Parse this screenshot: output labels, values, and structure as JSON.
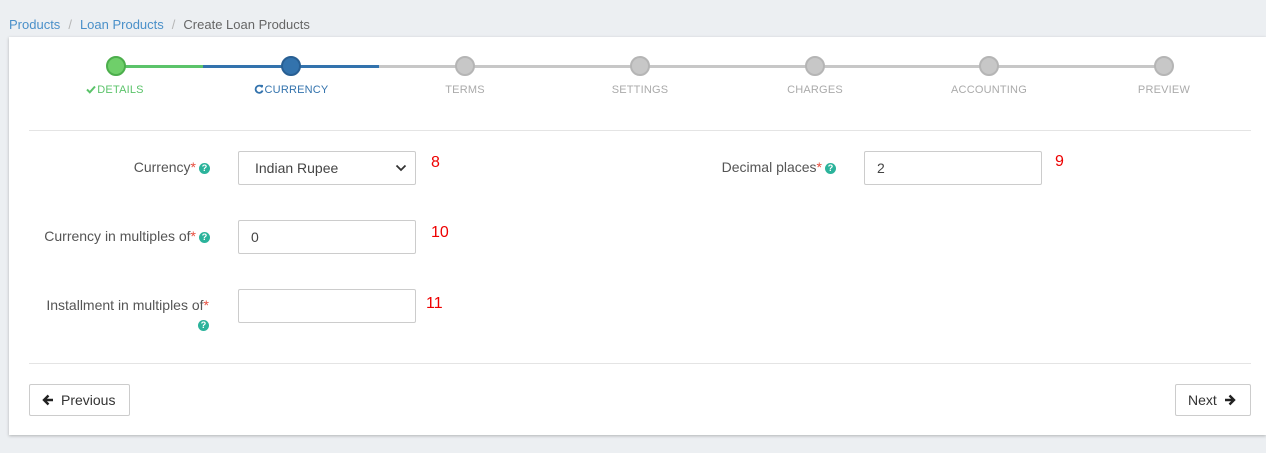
{
  "breadcrumb": {
    "items": [
      "Products",
      "Loan Products"
    ],
    "current": "Create Loan Products"
  },
  "stepper": {
    "steps": [
      {
        "label": "DETAILS",
        "state": "complete"
      },
      {
        "label": "CURRENCY",
        "state": "active"
      },
      {
        "label": "TERMS",
        "state": "pending"
      },
      {
        "label": "SETTINGS",
        "state": "pending"
      },
      {
        "label": "CHARGES",
        "state": "pending"
      },
      {
        "label": "ACCOUNTING",
        "state": "pending"
      },
      {
        "label": "PREVIEW",
        "state": "pending"
      }
    ]
  },
  "form": {
    "currency": {
      "label": "Currency",
      "required": "*",
      "value": "Indian Rupee",
      "annotation": "8"
    },
    "decimal_places": {
      "label": "Decimal places",
      "required": "*",
      "value": "2",
      "annotation": "9"
    },
    "currency_multiples": {
      "label": "Currency in multiples of",
      "required": "*",
      "value": "0",
      "annotation": "10"
    },
    "installment_multiples": {
      "label": "Installment in multiples of",
      "required": "*",
      "value": "",
      "annotation": "11"
    }
  },
  "buttons": {
    "previous": "Previous",
    "next": "Next"
  },
  "colors": {
    "complete": "#5bc36a",
    "active": "#3373ad",
    "pending": "#c7c7c7",
    "pending_text": "#aaaaaa",
    "help": "#2bb39b",
    "required": "#e74c3c",
    "annotation": "#ee0000",
    "link": "#4a90c9"
  }
}
